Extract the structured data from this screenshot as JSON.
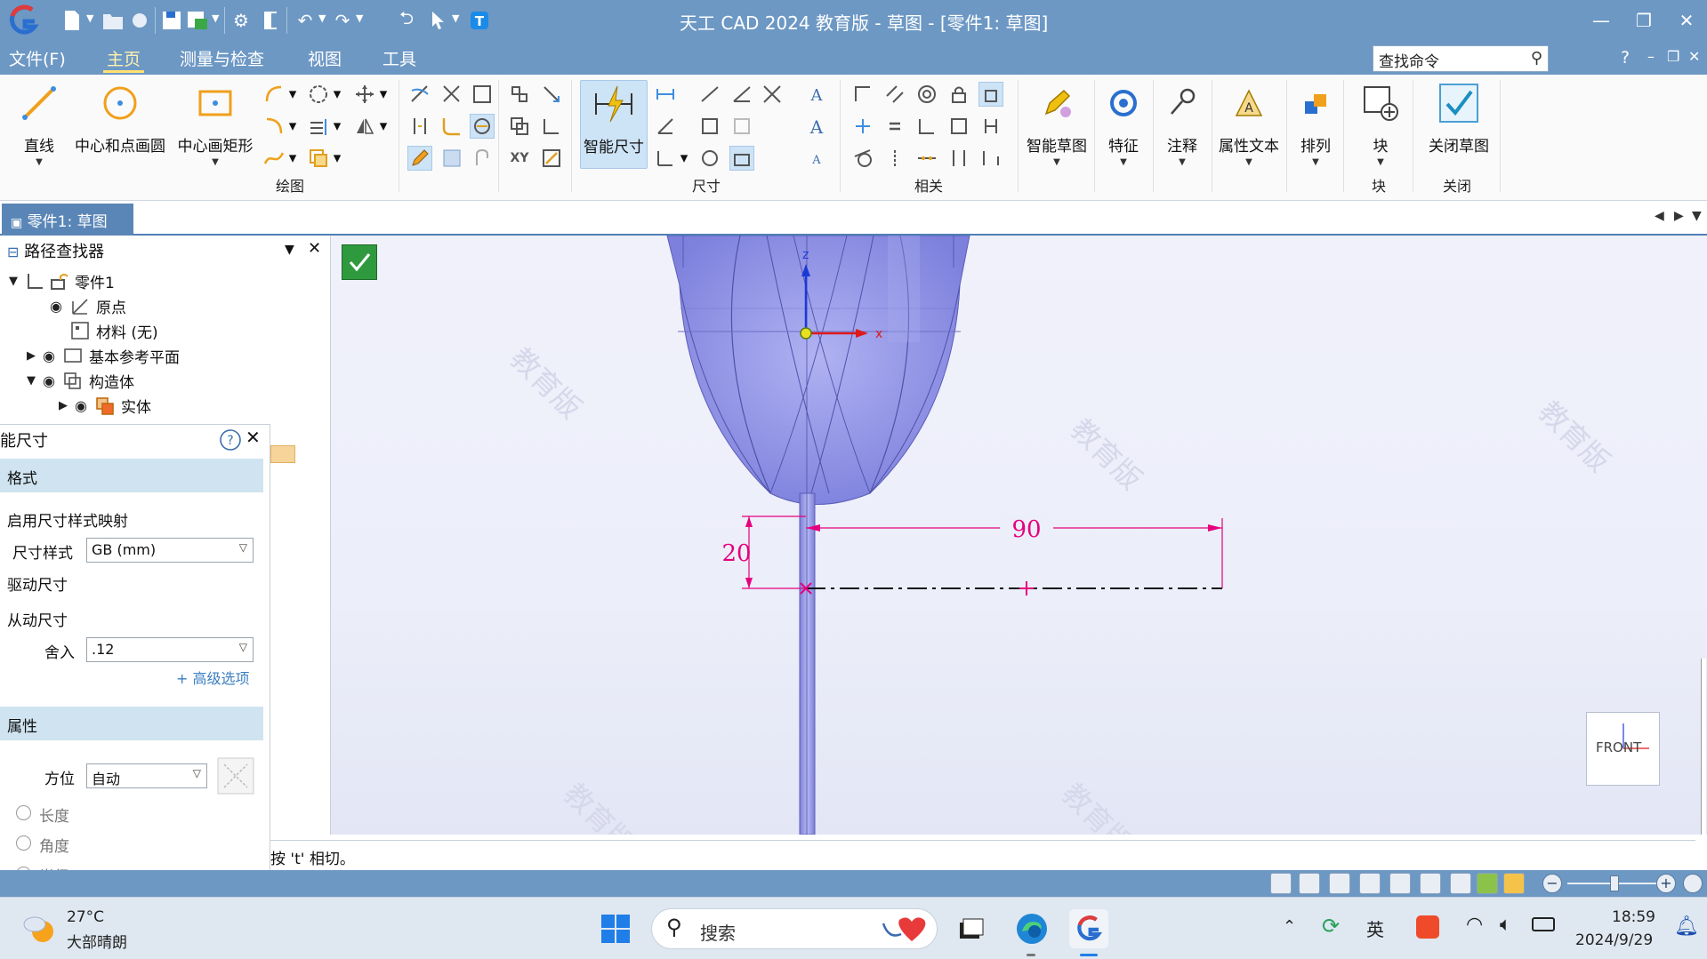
{
  "title_bar": {
    "title": "天工 CAD 2024 教育版 - 草图 - [零件1: 草图]"
  },
  "menu": {
    "tabs": [
      "文件(F)",
      "主页",
      "测量与检查",
      "视图",
      "工具"
    ],
    "active_tab": "主页",
    "search_placeholder": "查找命令",
    "help": "?"
  },
  "ribbon": {
    "draw_group": {
      "label": "绘图",
      "line": "直线",
      "circle": "中心和点画圆",
      "rect": "中心画矩形"
    },
    "dim_group": {
      "label": "尺寸",
      "smart_dim": "智能尺寸",
      "xy_label": "XY"
    },
    "rel_group": {
      "label": "相关"
    },
    "smart_sketch": "智能草图",
    "feature": "特征",
    "annotation": "注释",
    "property_text": "属性文本",
    "arrange": "排列",
    "block_group": {
      "label": "块",
      "block": "块"
    },
    "close_group": {
      "label": "关闭",
      "close_sketch": "关闭草图"
    }
  },
  "doc_tab": "零件1: 草图",
  "path_finder": {
    "title": "路径查找器",
    "tree": [
      {
        "label": "零件1"
      },
      {
        "label": "原点"
      },
      {
        "label": "材料 (无)"
      },
      {
        "label": "基本参考平面"
      },
      {
        "label": "构造体"
      },
      {
        "label": "实体"
      }
    ]
  },
  "properties": {
    "title": "能尺寸",
    "format_section": "格式",
    "enable_style_mapping": "启用尺寸样式映射",
    "dim_style_label": "尺寸样式",
    "dim_style_value": "GB (mm)",
    "driving": "驱动尺寸",
    "driven": "从动尺寸",
    "round_label": "舍入",
    "round_value": ".12",
    "advanced": "+ 高级选项",
    "attr_section": "属性",
    "orientation_label": "方位",
    "orientation_value": "自动",
    "length": "长度",
    "angle": "角度",
    "radius": "半径"
  },
  "viewport": {
    "axis_z": "z",
    "axis_x": "x",
    "dim_vertical": "20",
    "dim_horizontal": "90",
    "view_cube": "FRONT",
    "watermark": "教育版"
  },
  "prompt": "按 't' 相切。",
  "taskbar": {
    "temp": "27°C",
    "weather": "大部晴朗",
    "search": "搜索",
    "ime": "英",
    "time": "18:59",
    "date": "2024/9/29"
  },
  "colors": {
    "chrome_blue": "#6d98c4",
    "dimension_pink": "#e6007e",
    "body_purple": "#9597e8",
    "accent_green": "#2f9a3d"
  }
}
